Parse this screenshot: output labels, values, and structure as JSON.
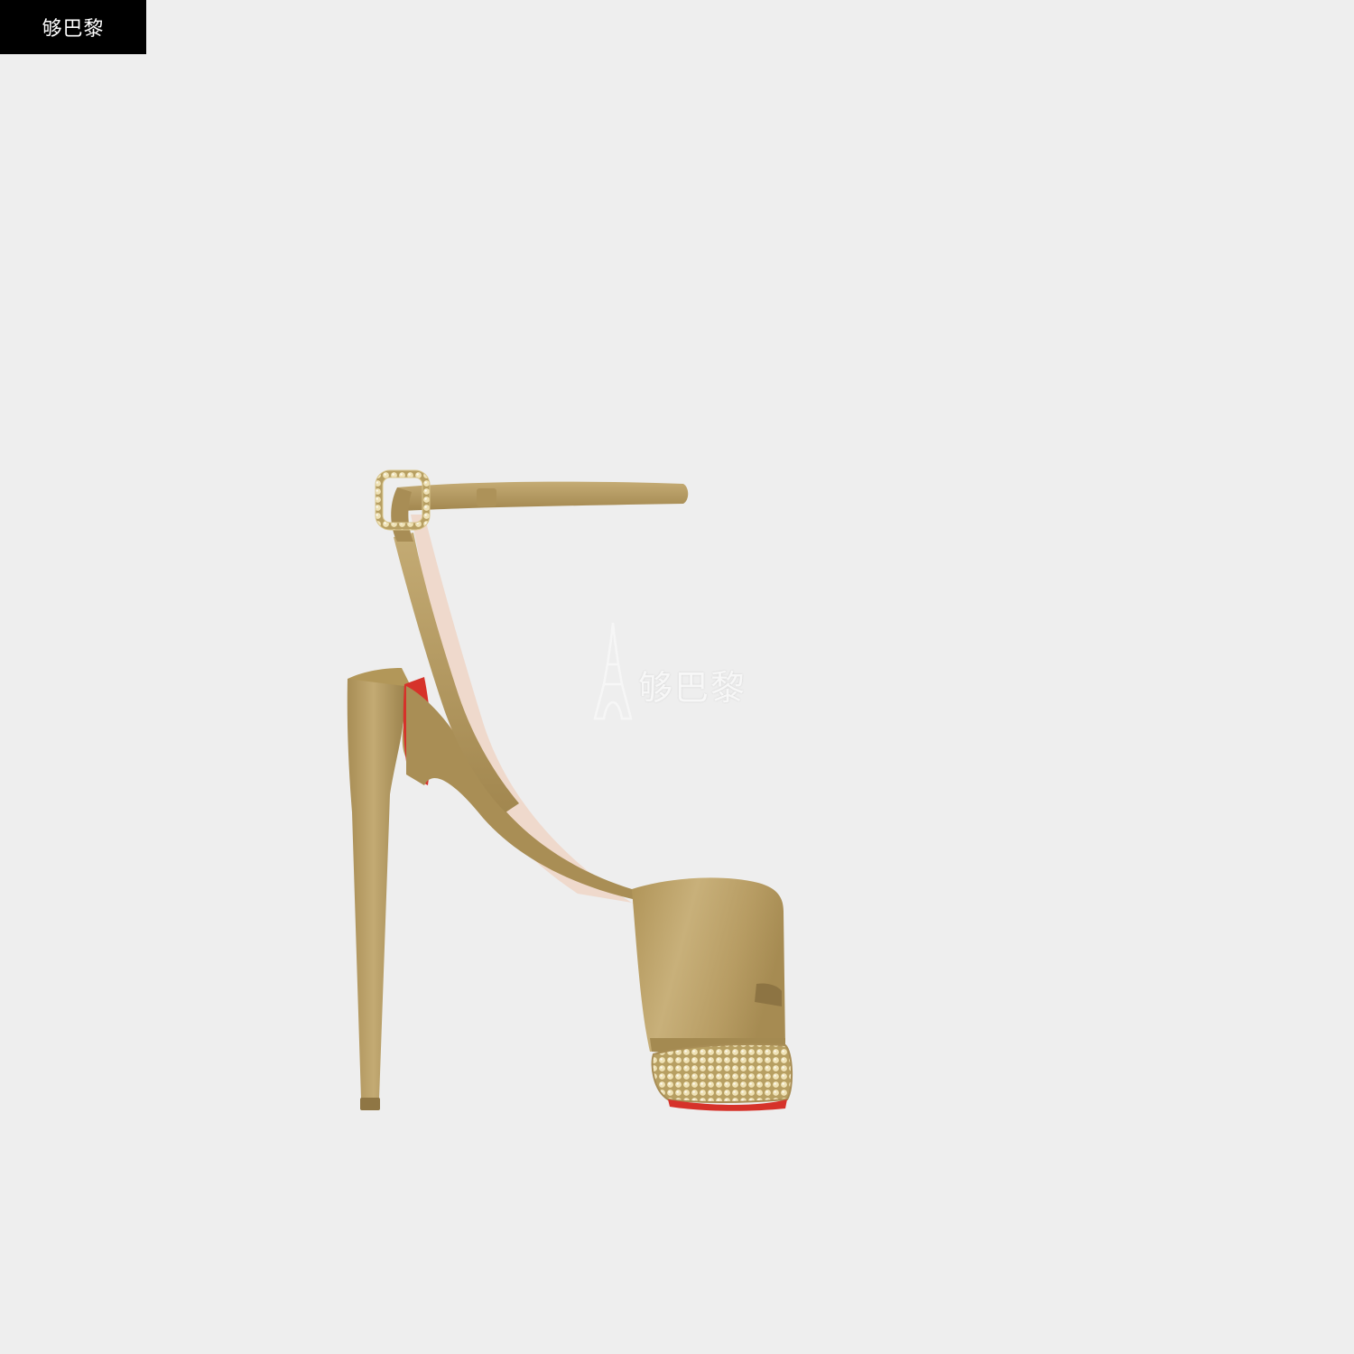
{
  "brand": {
    "badge_text": "够巴黎",
    "watermark_text": "够巴黎"
  },
  "image": {
    "subject": "gold-satin-platform-sandal",
    "background_color": "#eeeeee",
    "satin_color": "#b49a62",
    "lining_color": "#efd9cc",
    "heel_accent_color": "#d6322a",
    "crystal_color": "#d8c58d"
  },
  "icons": {
    "watermark_icon": "eiffel-tower-icon"
  }
}
